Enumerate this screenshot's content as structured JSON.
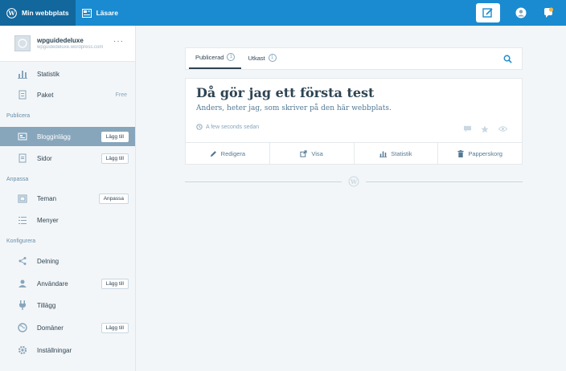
{
  "topbar": {
    "my_site": "Min webbplats",
    "reader": "Läsare"
  },
  "site": {
    "name": "wpguidedeluxe",
    "url": "wpguidedeluxe.wordpress.com",
    "menu": "···"
  },
  "sidebar": {
    "items": [
      {
        "label": "Statistik"
      },
      {
        "label": "Paket",
        "extra": "Free"
      },
      {
        "label": "Blogginlägg",
        "badge": "Lägg till"
      },
      {
        "label": "Sidor",
        "badge": "Lägg till"
      },
      {
        "label": "Teman",
        "badge": "Anpassa"
      },
      {
        "label": "Menyer"
      },
      {
        "label": "Delning"
      },
      {
        "label": "Användare",
        "badge": "Lägg till"
      },
      {
        "label": "Tillägg"
      },
      {
        "label": "Domäner",
        "badge": "Lägg till"
      },
      {
        "label": "Inställningar"
      }
    ],
    "sections": {
      "publish": "Publicera",
      "customize": "Anpassa",
      "configure": "Konfigurera"
    }
  },
  "tabs": {
    "published": "Publicerad",
    "published_count": "1",
    "drafts": "Utkast",
    "drafts_count": "1"
  },
  "post": {
    "title": "Då gör jag ett första test",
    "excerpt": "Anders, heter jag, som skriver på den här webbplats.",
    "time": "A few seconds sedan",
    "actions": {
      "edit": "Redigera",
      "view": "Visa",
      "stats": "Statistik",
      "trash": "Papperskorg"
    }
  },
  "colors": {
    "accent": "#1a8bd0",
    "selected": "#87a6bc"
  }
}
